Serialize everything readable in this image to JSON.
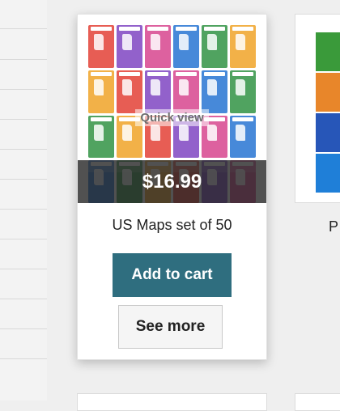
{
  "product": {
    "name": "US Maps set of 50",
    "price": "$16.99",
    "quick_view_label": "Quick view",
    "add_to_cart_label": "Add to cart",
    "see_more_label": "See more",
    "thumbnail_alt": "Collage of US state map cards"
  },
  "neighbor_product": {
    "name_fragment": "P"
  },
  "colors": {
    "price_bar": "#2b2b2b",
    "add_to_cart_bg": "#2f6e7f",
    "see_more_bg": "#f5f5f5",
    "page_bg": "#efefef",
    "tile_colors": [
      "#e23a2f",
      "#f0a020",
      "#2a8f3e",
      "#1f6fd1",
      "#d63f8a",
      "#7b3fc0"
    ]
  }
}
